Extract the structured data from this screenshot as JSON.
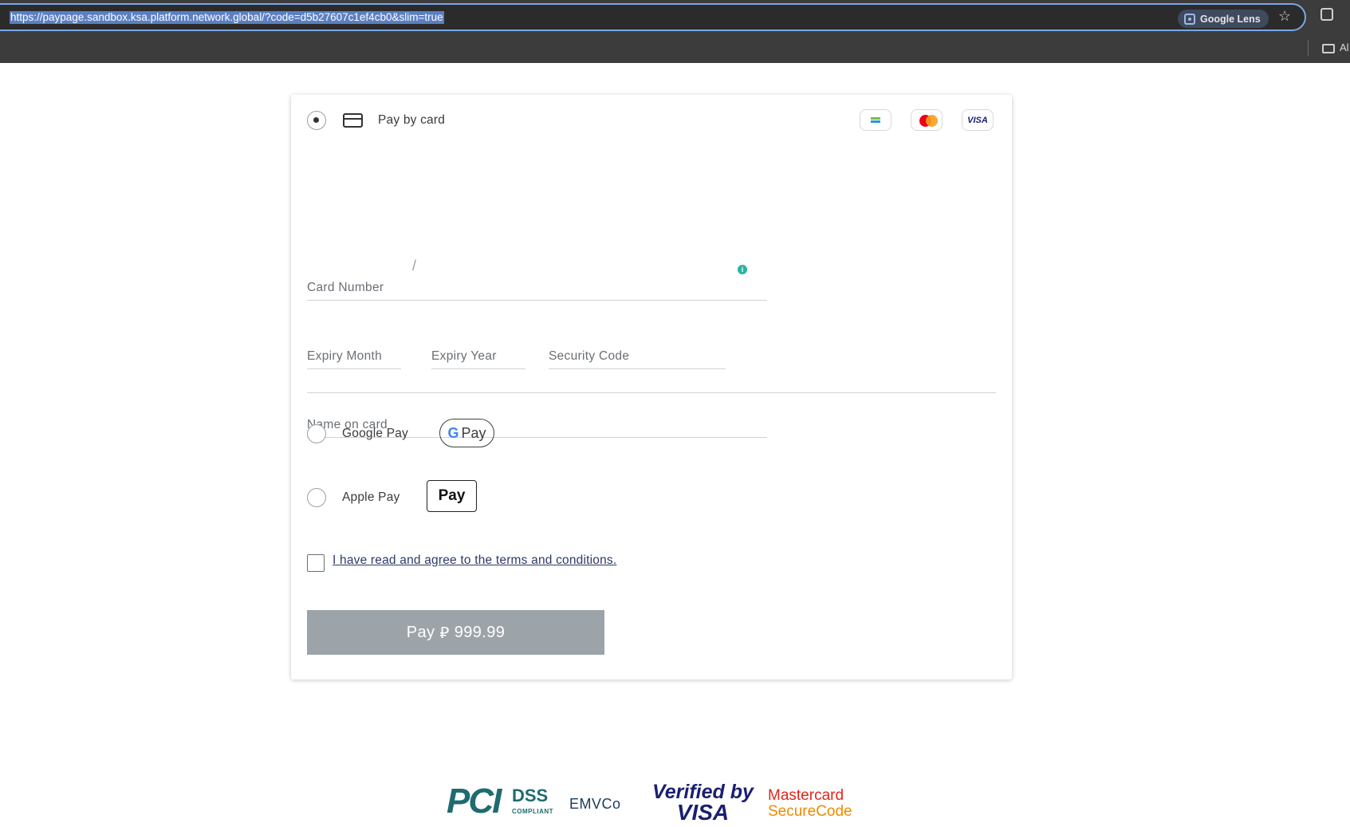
{
  "browser": {
    "url": "https://paypage.sandbox.ksa.platform.network.global/?code=d5b27607c1ef4cb0&slim=true",
    "lens_label": "Google Lens",
    "bookmarks_label": "Al"
  },
  "payment": {
    "pay_by_card_label": "Pay by card",
    "card_brands": [
      "mada-icon",
      "mastercard-icon",
      "visa-icon"
    ],
    "visa_text": "VISA",
    "fields": {
      "card_number_placeholder": "Card Number",
      "expiry_month_placeholder": "Expiry Month",
      "expiry_separator": "/",
      "expiry_year_placeholder": "Expiry Year",
      "security_code_placeholder": "Security Code",
      "name_on_card_placeholder": "Name on card"
    },
    "google_pay_label": "Google Pay",
    "google_pay_badge_g": "G",
    "google_pay_badge_text": "Pay",
    "apple_pay_label": "Apple Pay",
    "apple_pay_badge": "Pay",
    "terms_text": "I have read and agree to the terms and conditions.",
    "pay_button_prefix": "Pay",
    "currency_symbol": "⃁",
    "amount": "999.99"
  },
  "footer_logos": {
    "pci": "PCI",
    "dss": "DSS",
    "dss_sub": "COMPLIANT",
    "emvco": "EMVCo",
    "verified_by": "Verified by",
    "visa": "VISA",
    "mastercard": "Mastercard",
    "securecode": "SecureCode"
  },
  "colors": {
    "pay_button_disabled": "#9ca3a9",
    "info_icon": "#2bb3a3",
    "terms_link": "#2d3a66"
  }
}
